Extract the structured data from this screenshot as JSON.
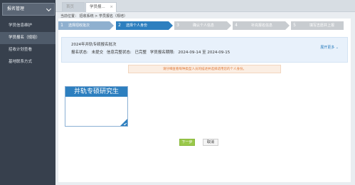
{
  "sidebar": {
    "header": "报名管理",
    "items": [
      {
        "label": "学员信息维护"
      },
      {
        "label": "学员报名（规培）"
      },
      {
        "label": "招收计划查看"
      },
      {
        "label": "基地联系方式"
      }
    ]
  },
  "tabs": {
    "home": "首页",
    "current": "学员报..."
  },
  "breadcrumb": "当前位置：   招收系统 > 学员报名（规培）",
  "steps": [
    {
      "num": "1",
      "label": "选择招收批次"
    },
    {
      "num": "2",
      "label": "选择个人身份"
    },
    {
      "num": "3",
      "label": "确认个人信息"
    },
    {
      "num": "4",
      "label": "补充报名信息"
    },
    {
      "num": "5",
      "label": "填写志愿并上报"
    }
  ],
  "batch": {
    "title": "2024年并轨专硕报名批次",
    "status_label": "报名状态:",
    "status_value": "未提交",
    "complete_label": "信息完整状态:",
    "complete_value": "已完整",
    "period_label": "学员报名期限:",
    "period_value": "2024-09-14 至 2024-09-15",
    "expand": "展开更多"
  },
  "notice": "请仔细查看每种类型人员的描述并选择适用您的个人身份。",
  "identity_card": {
    "title": "并轨专硕研究生"
  },
  "buttons": {
    "next": "下一步",
    "cancel": "取消"
  },
  "colors": {
    "primary": "#2d7fbf",
    "sidebar": "#37404d",
    "next_button": "#9ac84a",
    "notice_text": "#e07a3a"
  }
}
